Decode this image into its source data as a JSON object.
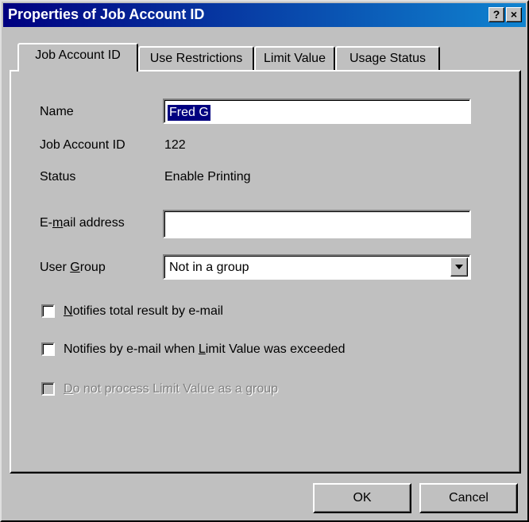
{
  "window": {
    "title": "Properties of Job Account ID",
    "help_button": "?",
    "close_button": "×"
  },
  "tabs": [
    {
      "label": "Job Account ID",
      "active": true
    },
    {
      "label": "Use Restrictions",
      "active": false
    },
    {
      "label": "Limit Value",
      "active": false
    },
    {
      "label": "Usage Status",
      "active": false
    }
  ],
  "form": {
    "name_label": "Name",
    "name_value": "Fred G",
    "job_account_id_label": "Job Account ID",
    "job_account_id_value": "122",
    "status_label": "Status",
    "status_value": "Enable Printing",
    "email_label_pre": "E-",
    "email_label_mnemonic": "m",
    "email_label_post": "ail address",
    "email_value": "",
    "user_group_label_pre": "User ",
    "user_group_label_mnemonic": "G",
    "user_group_label_post": "roup",
    "user_group_value": "Not in a group"
  },
  "checkboxes": {
    "notify_total": {
      "mnemonic": "N",
      "rest": "otifies total result by e-mail",
      "checked": false,
      "enabled": true
    },
    "notify_exceeded": {
      "pre": "Notifies by e-mail when ",
      "mnemonic": "L",
      "post": "imit Value was exceeded",
      "checked": false,
      "enabled": true
    },
    "no_group_limit": {
      "mnemonic": "D",
      "rest": "o not process Limit Value as a group",
      "checked": false,
      "enabled": false
    }
  },
  "buttons": {
    "ok": "OK",
    "cancel": "Cancel"
  }
}
